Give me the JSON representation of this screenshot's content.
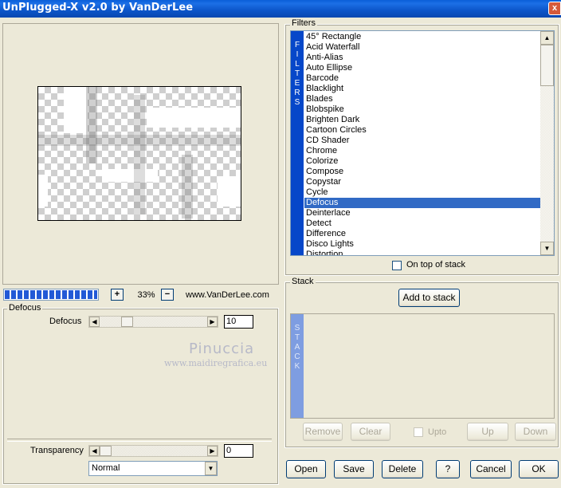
{
  "window": {
    "title": "UnPlugged-X v2.0 by VanDerLee",
    "close_label": "x"
  },
  "preview": {
    "zoom": "33%",
    "zoom_in": "+",
    "zoom_out": "−",
    "website": "www.VanDerLee.com",
    "progress": 1.0
  },
  "params": {
    "legend": "Defocus",
    "defocus_label": "Defocus",
    "defocus_value": "10",
    "transparency_label": "Transparency",
    "transparency_value": "0",
    "blend_mode": "Normal"
  },
  "watermark": {
    "line1": "Pinuccia",
    "line2": "www.maidiregrafica.eu"
  },
  "filters": {
    "legend": "Filters",
    "strip_letters": [
      "F",
      "I",
      "L",
      "T",
      "E",
      "R",
      "S"
    ],
    "items": [
      "45° Rectangle",
      "Acid Waterfall",
      "Anti-Alias",
      "Auto Ellipse",
      "Barcode",
      "Blacklight",
      "Blades",
      "Blobspike",
      "Brighten Dark",
      "Cartoon Circles",
      "CD Shader",
      "Chrome",
      "Colorize",
      "Compose",
      "Copystar",
      "Cycle",
      "Defocus",
      "Deinterlace",
      "Detect",
      "Difference",
      "Disco Lights",
      "Distortion"
    ],
    "selected_index": 16,
    "on_top_label": "On top of stack"
  },
  "stack": {
    "legend": "Stack",
    "add_label": "Add to stack",
    "strip_letters": [
      "S",
      "T",
      "A",
      "C",
      "K"
    ],
    "remove_label": "Remove",
    "clear_label": "Clear",
    "upto_label": "Upto",
    "up_label": "Up",
    "down_label": "Down"
  },
  "footer": {
    "open": "Open",
    "save": "Save",
    "delete": "Delete",
    "help": "?",
    "cancel": "Cancel",
    "ok": "OK"
  },
  "colors": {
    "title_bar": "#0a5fd8",
    "selection": "#316ac5",
    "filters_strip": "#0647c9",
    "stack_strip": "#7e9de1"
  }
}
